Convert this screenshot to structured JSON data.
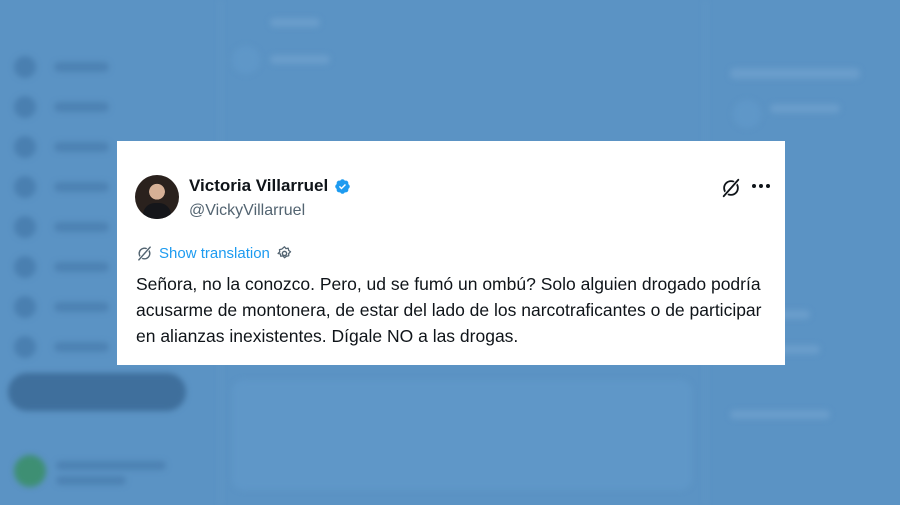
{
  "tweet": {
    "author_name": "Victoria Villarruel",
    "author_handle": "@VickyVillarruel",
    "translate_label": "Show translation",
    "text": "Señora, no la conozco. Pero, ud se fumó un ombú? Solo alguien drogado podría acusarme de montonera, de estar del lado de los narcotraficantes o de participar en alianzas inexistentes. Dígale NO a las drogas."
  },
  "icons": {
    "verified": "verified-badge-icon",
    "grok": "grok-icon",
    "more": "more-dots-icon",
    "translate": "translate-icon",
    "settings": "gear-icon"
  },
  "colors": {
    "background_overlay": "#5b93c4",
    "link": "#1d9bf0",
    "text": "#0f1419",
    "muted": "#536471",
    "verified": "#1d9bf0"
  }
}
